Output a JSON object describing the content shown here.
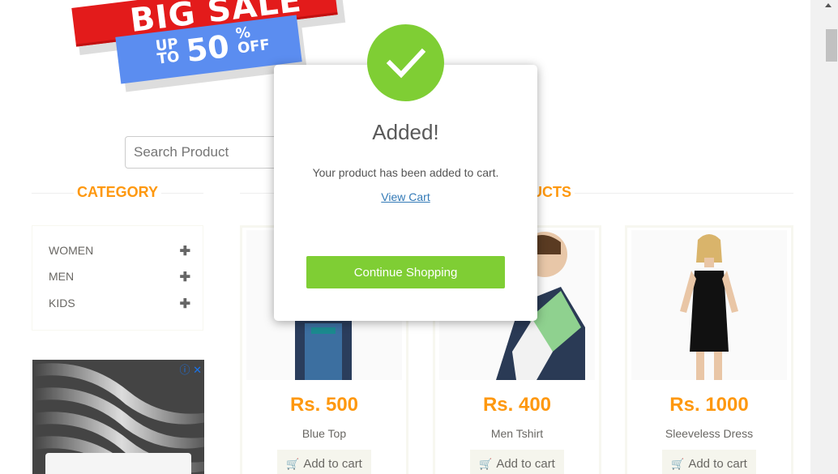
{
  "banner": {
    "line1": "BIG SALE",
    "upto": "UP TO",
    "percent": "50",
    "off": "% OFF"
  },
  "search": {
    "placeholder": "Search Product"
  },
  "sections": {
    "category": "CATEGORY",
    "features_partial": "UCTS"
  },
  "categories": [
    {
      "label": "WOMEN"
    },
    {
      "label": "MEN"
    },
    {
      "label": "KIDS"
    }
  ],
  "products": [
    {
      "price": "Rs. 500",
      "name": "Blue Top",
      "button": "Add to cart"
    },
    {
      "price": "Rs. 400",
      "name": "Men Tshirt",
      "button": "Add to cart"
    },
    {
      "price": "Rs. 1000",
      "name": "Sleeveless Dress",
      "button": "Add to cart"
    }
  ],
  "modal": {
    "title": "Added!",
    "text": "Your product has been added to cart.",
    "link": "View Cart",
    "button": "Continue Shopping"
  },
  "icons": {
    "check": "check-icon",
    "plus": "plus-icon",
    "cart": "cart-icon",
    "ad_info": "ad-info-icon"
  },
  "colors": {
    "accent": "#fe980f",
    "success": "#7fce34"
  }
}
